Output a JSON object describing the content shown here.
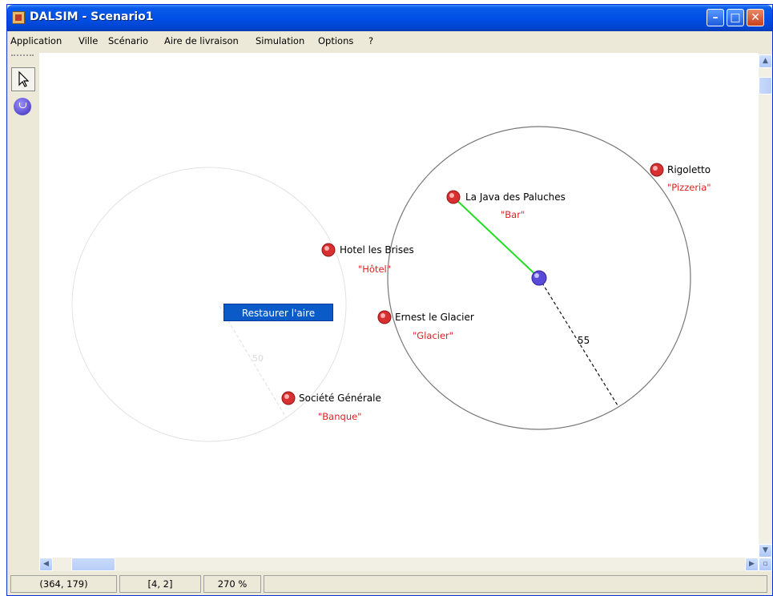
{
  "window": {
    "title": "DALSIM - Scenario1"
  },
  "menu": [
    "Application",
    "Ville",
    "Scénario",
    "Aire de livraison",
    "Simulation",
    "Options",
    "?"
  ],
  "canvas": {
    "places": [
      {
        "name": "Rigoletto",
        "type": "\"Pizzeria\""
      },
      {
        "name": "La Java des Paluches",
        "type": "\"Bar\""
      },
      {
        "name": "Hotel les Brises",
        "type": "\"Hôtel\""
      },
      {
        "name": "Ernest le Glacier",
        "type": "\"Glacier\""
      },
      {
        "name": "Société Générale",
        "type": "\"Banque\""
      }
    ],
    "active_area_radius_label": "55",
    "inactive_area_radius_label": "50",
    "context_menu_item": "Restaurer l'aire"
  },
  "status": {
    "coords": "(364, 179)",
    "cell": "[4, 2]",
    "zoom": "270 %"
  },
  "colors": {
    "title_blue": "#0050E6",
    "place_red": "#E02020",
    "connection_green": "#22DD22",
    "node_purple": "#5A4AD8"
  }
}
